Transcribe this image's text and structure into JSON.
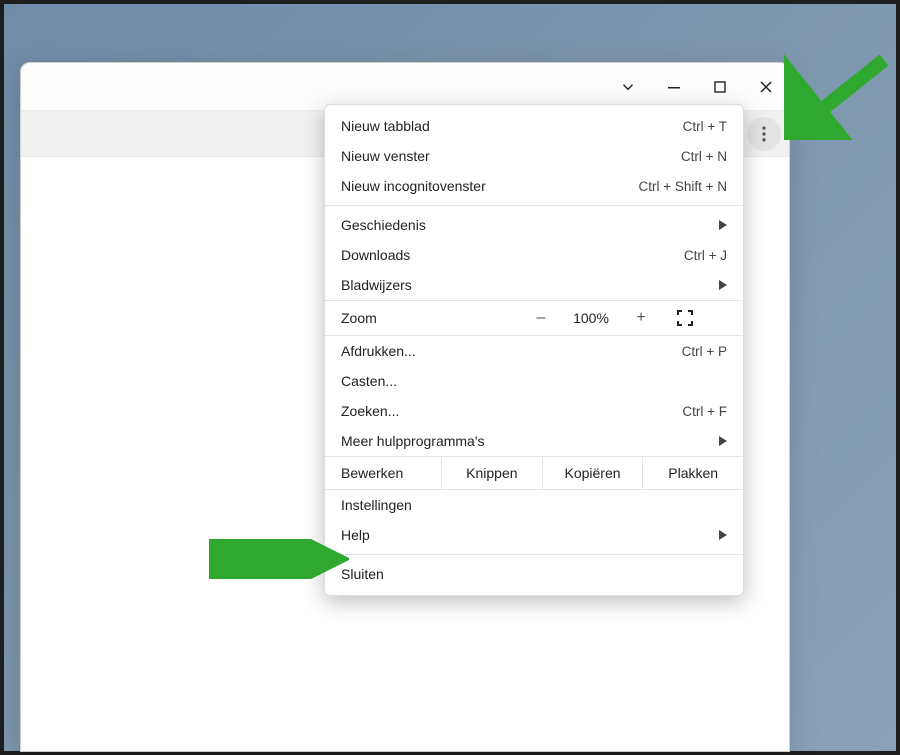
{
  "menu": {
    "new_tab": {
      "label": "Nieuw tabblad",
      "shortcut": "Ctrl + T"
    },
    "new_window": {
      "label": "Nieuw venster",
      "shortcut": "Ctrl + N"
    },
    "new_incognito": {
      "label": "Nieuw incognitovenster",
      "shortcut": "Ctrl + Shift + N"
    },
    "history": {
      "label": "Geschiedenis"
    },
    "downloads": {
      "label": "Downloads",
      "shortcut": "Ctrl + J"
    },
    "bookmarks": {
      "label": "Bladwijzers"
    },
    "zoom": {
      "label": "Zoom",
      "value": "100%",
      "minus": "–",
      "plus": "+"
    },
    "print": {
      "label": "Afdrukken...",
      "shortcut": "Ctrl + P"
    },
    "cast": {
      "label": "Casten..."
    },
    "find": {
      "label": "Zoeken...",
      "shortcut": "Ctrl + F"
    },
    "more_tools": {
      "label": "Meer hulpprogramma's"
    },
    "edit": {
      "label": "Bewerken",
      "cut": "Knippen",
      "copy": "Kopiëren",
      "paste": "Plakken"
    },
    "settings": {
      "label": "Instellingen"
    },
    "help": {
      "label": "Help"
    },
    "exit": {
      "label": "Sluiten"
    }
  },
  "colors": {
    "arrow": "#2fa82f"
  }
}
